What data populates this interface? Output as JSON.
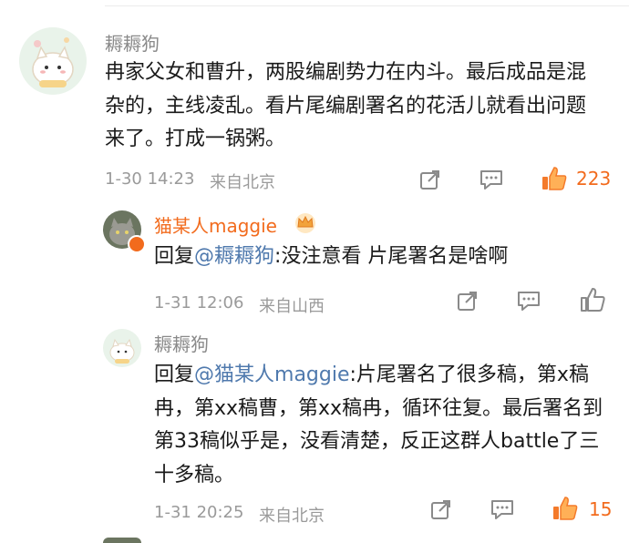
{
  "comments": [
    {
      "author": "耨耨狗",
      "text": "冉家父女和曹升，两股编剧势力在内斗。最后成品是混杂的，主线凌乱。看片尾编剧署名的花活儿就看出问题来了。打成一锅粥。",
      "time": "1-30 14:23",
      "location": "来自北京",
      "likes": "223"
    }
  ],
  "replies": [
    {
      "author": "猫某人maggie",
      "prefix": "回复",
      "mention": "@耨耨狗",
      "text": ":没注意看 片尾署名是啥啊",
      "time": "1-31 12:06",
      "location": "来自山西",
      "likes": ""
    },
    {
      "author": "耨耨狗",
      "prefix": "回复",
      "mention": "@猫某人maggie",
      "text": ":片尾署名了很多稿，第x稿冉，第xx稿曹，第xx稿冉，循环往复。最后署名到第33稿似乎是，没看清楚，反正这群人battle了三十多稿。",
      "time": "1-31 20:25",
      "location": "来自北京",
      "likes": "15"
    }
  ],
  "colors": {
    "accent": "#f26b1d",
    "mention": "#4f79ad",
    "meta": "#9a9a9a"
  },
  "icons": [
    "share-icon",
    "comment-icon",
    "like-icon",
    "vip-crown-icon",
    "badge-icon"
  ]
}
